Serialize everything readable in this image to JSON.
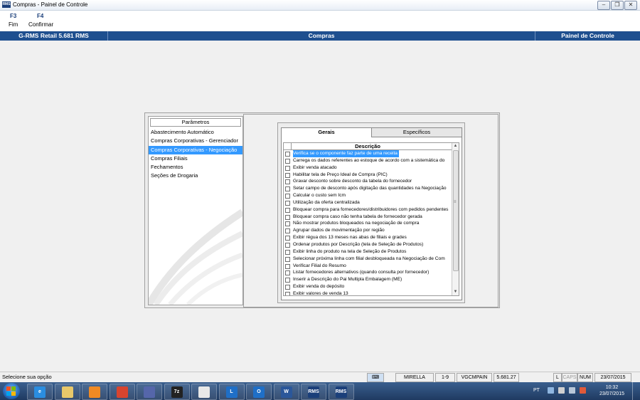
{
  "window": {
    "title": "Compras - Painel de Controle",
    "app_icon_label": "RMS"
  },
  "toolbar": {
    "buttons": [
      {
        "key": "F3",
        "label": "Fim"
      },
      {
        "key": "F4",
        "label": "Confirmar"
      }
    ]
  },
  "header_bar": {
    "product": "G-RMS Retail 5.681 RMS",
    "module": "Compras",
    "screen": "Painel de Controle",
    "color": "#1e4f8f"
  },
  "parametros": {
    "header": "Parâmetros",
    "items": [
      "Abastecimento Automático",
      "Compras Corporativas - Gerenciador",
      "Compras Corporativas - Negociação",
      "Compras Filiais",
      "Fechamentos",
      "Seções de Drogaria"
    ],
    "selected_index": 2
  },
  "tabs": {
    "items": [
      "Gerais",
      "Específicos"
    ],
    "active_index": 0
  },
  "grid": {
    "column_header": "Descrição",
    "selected_index": 0,
    "rows": [
      "Verifica se o componente faz parte de uma receita",
      "Carrega os dados referentes ao estoque de acordo com a sistemática do",
      "Exibir venda atacado",
      "Habilitar tela de Preço Ideal de Compra (PIC)",
      "Gravar desconto sobre desconto da tabela do fornecedor",
      "Setar campo de desconto após digitação das quantidades na Negociação",
      "Calcular o custo sem Icm",
      "Utilização da oferta centralizada",
      "Bloquear compra para fornecedores/distribuidores com pedidos pendentes",
      "Bloquear compra caso não tenha tabela de fornecedor gerada",
      "Não mostrar produtos bloqueados na negociação de compra",
      "Agrupar dados de movimentação por região",
      "Exibir régua dos 13 meses nas abas de filiais e grades",
      "Ordenar produtos por Descrição (tela de Seleção de Produtos)",
      "Exibir linha do produto na tela de Seleção de Produtos",
      "Selecionar próxima linha com filial desbloqueada na Negociação de Com",
      "Verificar Filial do Resumo",
      "Listar fornecedores alternativos (quando consulta por fornecedor)",
      "Inserir a Descrição do Pai Multipla Embalagem (ME)",
      "Exibir venda do depósito",
      "Exibir valores de venda 13"
    ]
  },
  "statusbar": {
    "message": "Selecione sua opção",
    "user": "MIRELLA",
    "range": "1-9",
    "program": "VGCMPAIN",
    "version": "5.681.27",
    "l": "L",
    "caps": "CAPS",
    "num": "NUM",
    "date": "23/07/2015"
  },
  "taskbar": {
    "apps": [
      {
        "name": "internet-explorer-icon",
        "label": "e",
        "color": "#2a8de0"
      },
      {
        "name": "file-explorer-icon",
        "label": "",
        "color": "#e8c86a"
      },
      {
        "name": "media-player-icon",
        "label": "",
        "color": "#f08a24"
      },
      {
        "name": "chrome-icon",
        "label": "",
        "color": "#d8442f"
      },
      {
        "name": "network-tool-icon",
        "label": "",
        "color": "#5566aa"
      },
      {
        "name": "7zip-icon",
        "label": "7z",
        "color": "#222222"
      },
      {
        "name": "document-icon",
        "label": "",
        "color": "#e8e8e8"
      },
      {
        "name": "lync-icon",
        "label": "L",
        "color": "#1f6fc7"
      },
      {
        "name": "outlook-icon",
        "label": "O",
        "color": "#1f6fc7"
      },
      {
        "name": "word-icon",
        "label": "W",
        "color": "#2b579a"
      },
      {
        "name": "rms-app-icon",
        "label": "RMS",
        "color": "#1b3f7a"
      },
      {
        "name": "rms-app-icon-2",
        "label": "RMS",
        "color": "#1b3f7a"
      }
    ],
    "language": "PT",
    "time": "10:32",
    "date": "23/07/2015"
  }
}
